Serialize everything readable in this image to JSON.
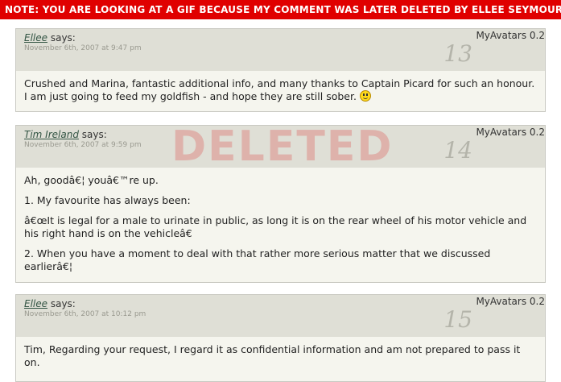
{
  "banner": {
    "text": "NOTE: YOU ARE LOOKING AT A GIF BECAUSE MY COMMENT WAS LATER DELETED BY ELLEE SEYMOUR"
  },
  "stamp": {
    "text": "DELETED"
  },
  "comments": [
    {
      "author": "Ellee",
      "says": "says:",
      "date": "November 6th, 2007 at 9:47 pm",
      "avatars": "MyAvatars 0.2",
      "number": "13",
      "paragraphs": [
        "Crushed and Marina, fantastic additional info, and many thanks to Captain Picard for such an honour. I am just going to feed my goldfish - and hope they are still sober."
      ],
      "smiley_icon": "smiley-icon"
    },
    {
      "author": "Tim Ireland",
      "says": "says:",
      "date": "November 6th, 2007 at 9:59 pm",
      "avatars": "MyAvatars 0.2",
      "number": "14",
      "paragraphs": [
        "Ah, goodâ€¦ youâ€™re up.",
        "1. My favourite has always been:",
        "â€œIt is legal for a male to urinate in public, as long it is on the rear wheel of his motor vehicle and his right hand is on the vehicleâ€",
        "2. When you have a moment to deal with that rather more serious matter that we discussed earlierâ€¦"
      ]
    },
    {
      "author": "Ellee",
      "says": "says:",
      "date": "November 6th, 2007 at 10:12 pm",
      "avatars": "MyAvatars 0.2",
      "number": "15",
      "paragraphs": [
        "Tim, Regarding your request, I regard it as confidential information and am not prepared to pass it on."
      ]
    }
  ]
}
